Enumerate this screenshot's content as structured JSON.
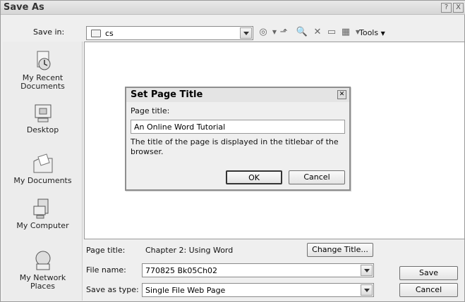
{
  "dialog": {
    "title": "Save As",
    "help_label": "?",
    "close_label": "X",
    "save_in_label": "Save in:",
    "folder_value": "cs",
    "tools_label": "Tools",
    "page_title_label": "Page title:",
    "page_title_value": "Chapter 2: Using Word",
    "change_title_button": "Change Title...",
    "file_name_label": "File name:",
    "file_name_value": "770825 Bk05Ch02",
    "save_as_type_label": "Save as type:",
    "save_as_type_value": "Single File Web Page",
    "save_button": "Save",
    "cancel_button": "Cancel"
  },
  "places": [
    {
      "label_line1": "My Recent",
      "label_line2": "Documents"
    },
    {
      "label_line1": "Desktop",
      "label_line2": ""
    },
    {
      "label_line1": "My Documents",
      "label_line2": ""
    },
    {
      "label_line1": "My Computer",
      "label_line2": ""
    },
    {
      "label_line1": "My Network",
      "label_line2": "Places"
    }
  ],
  "modal": {
    "title": "Set Page Title",
    "page_title_label": "Page title:",
    "page_title_value": "An Online Word Tutorial",
    "description": "The title of the page is displayed in the titlebar of the browser.",
    "ok_button": "OK",
    "cancel_button": "Cancel"
  }
}
